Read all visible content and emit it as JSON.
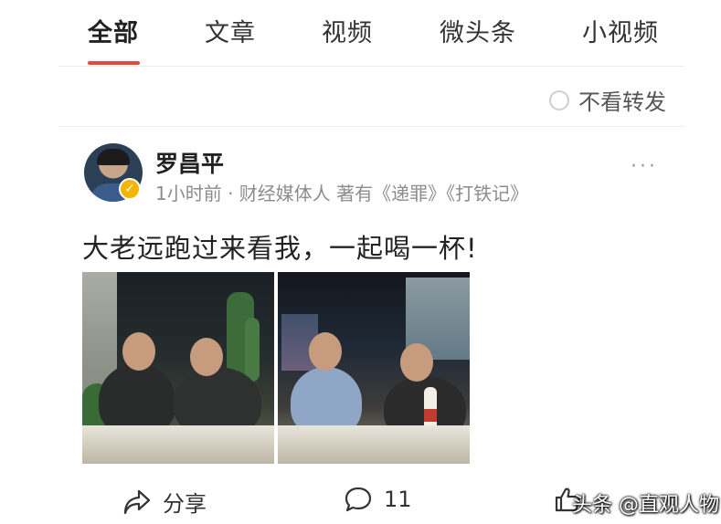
{
  "tabs": [
    {
      "label": "全部",
      "active": true
    },
    {
      "label": "文章",
      "active": false
    },
    {
      "label": "视频",
      "active": false
    },
    {
      "label": "微头条",
      "active": false
    },
    {
      "label": "小视频",
      "active": false
    }
  ],
  "filter": {
    "label": "不看转发"
  },
  "post": {
    "author": "罗昌平",
    "meta": "1小时前 · 财经媒体人 著有《递罪》《打铁记》",
    "text": "大老远跑过来看我，一起喝一杯!",
    "more": "···"
  },
  "actions": {
    "share_label": "分享",
    "comment_count": "11"
  },
  "watermark": "头条 @直观人物",
  "colors": {
    "accent": "#e8473d",
    "verified": "#f5b400"
  }
}
